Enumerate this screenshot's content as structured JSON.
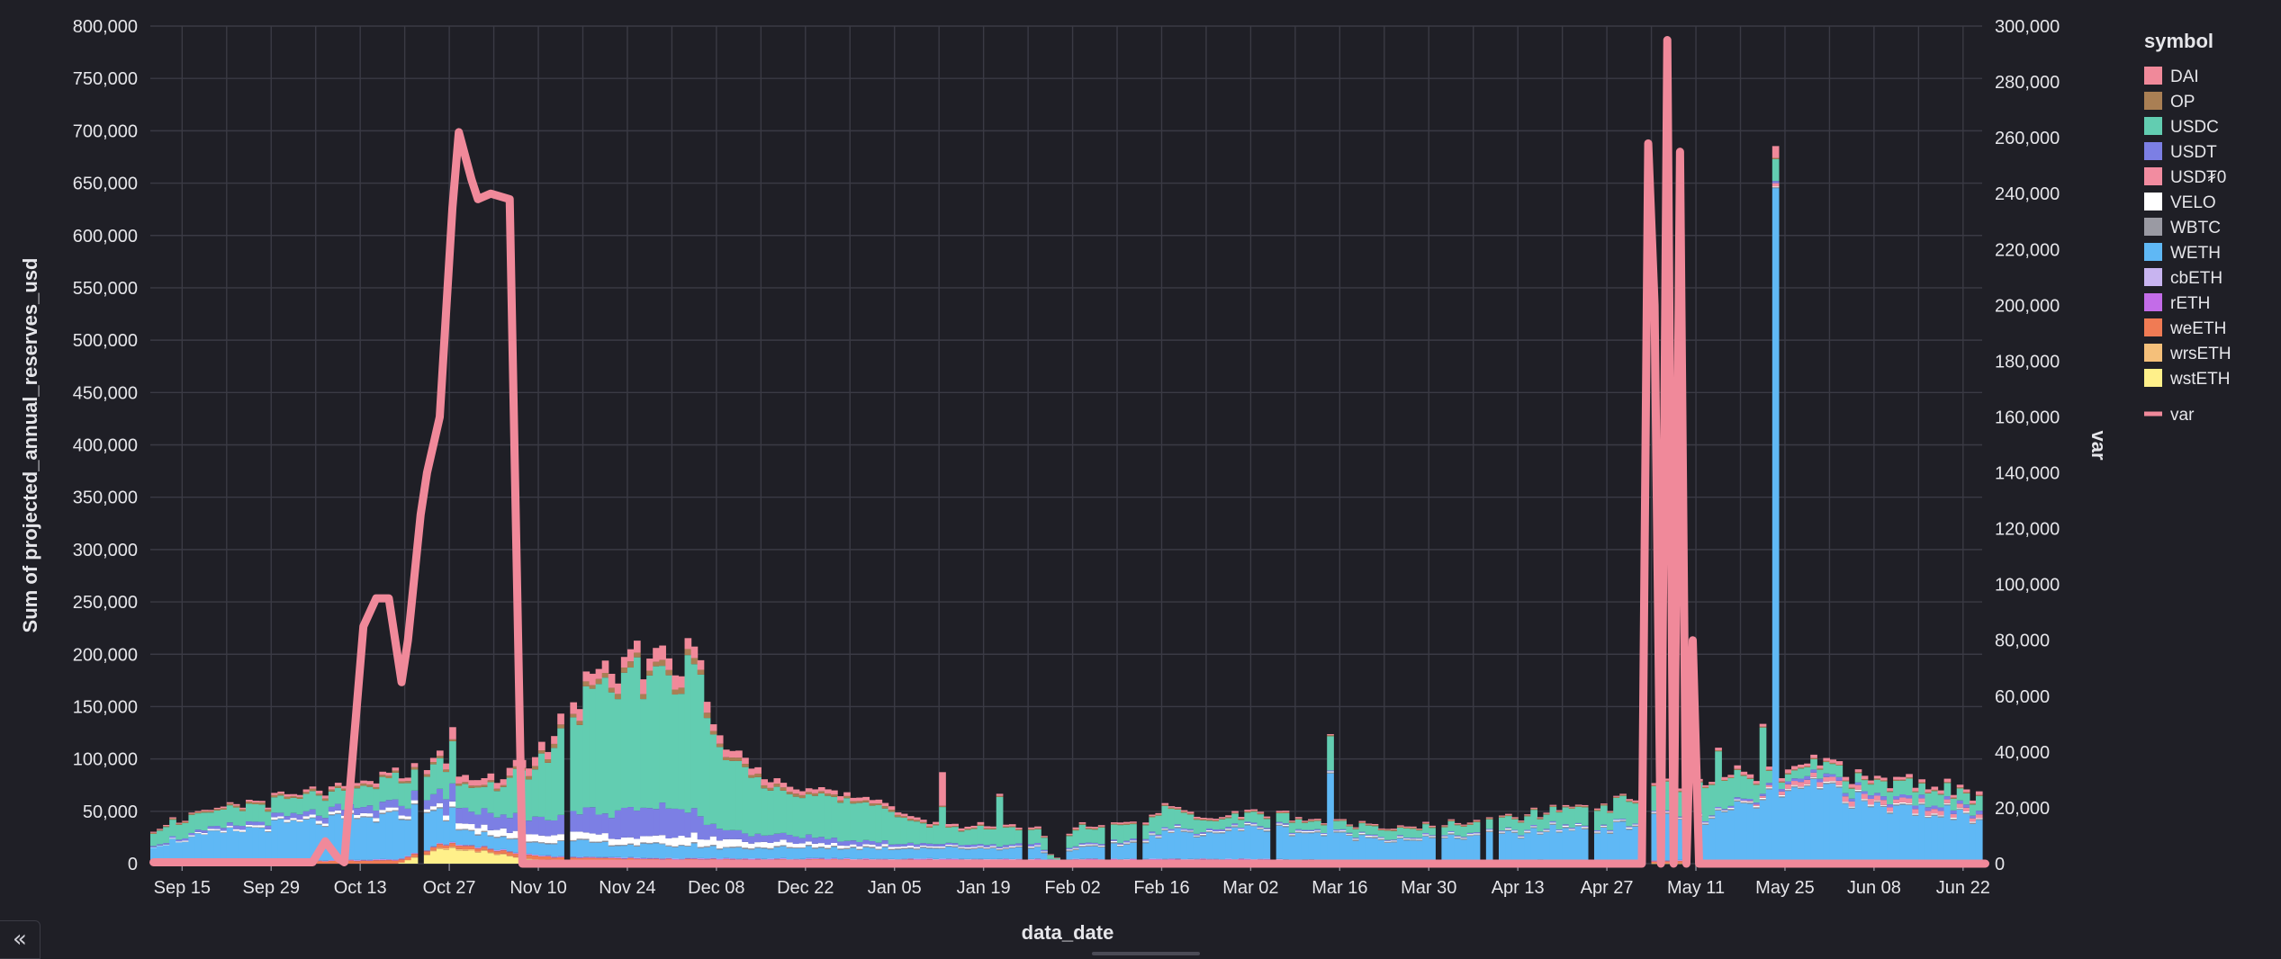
{
  "chart_data": {
    "type": "bar",
    "stacked": true,
    "xlabel": "data_date",
    "ylabel": "Sum of projected_annual_reserves_usd",
    "y2label": "var",
    "ylim": [
      0,
      800000
    ],
    "y2lim": [
      0,
      300000
    ],
    "yticks": [
      0,
      50000,
      100000,
      150000,
      200000,
      250000,
      300000,
      350000,
      400000,
      450000,
      500000,
      550000,
      600000,
      650000,
      700000,
      750000,
      800000
    ],
    "ytick_labels": [
      "0",
      "50,000",
      "100,000",
      "150,000",
      "200,000",
      "250,000",
      "300,000",
      "350,000",
      "400,000",
      "450,000",
      "500,000",
      "550,000",
      "600,000",
      "650,000",
      "700,000",
      "750,000",
      "800,000"
    ],
    "y2ticks": [
      0,
      20000,
      40000,
      60000,
      80000,
      100000,
      120000,
      140000,
      160000,
      180000,
      200000,
      220000,
      240000,
      260000,
      280000,
      300000
    ],
    "y2tick_labels": [
      "0",
      "20,000",
      "40,000",
      "60,000",
      "80,000",
      "100,000",
      "120,000",
      "140,000",
      "160,000",
      "180,000",
      "200,000",
      "220,000",
      "240,000",
      "260,000",
      "280,000",
      "300,000"
    ],
    "x_start": "Sep 10",
    "x_end": "Jun 25",
    "xtick_labels": [
      "Sep 15",
      "Sep 29",
      "Oct 13",
      "Oct 27",
      "Nov 10",
      "Nov 24",
      "Dec 08",
      "Dec 22",
      "Jan 05",
      "Jan 19",
      "Feb 02",
      "Feb 16",
      "Mar 02",
      "Mar 16",
      "Mar 30",
      "Apr 13",
      "Apr 27",
      "May 11",
      "May 25",
      "Jun 08",
      "Jun 22"
    ],
    "grid": true,
    "legend_title": "symbol",
    "legend_position": "right",
    "series_names": [
      "DAI",
      "OP",
      "USDC",
      "USDT",
      "USD₮0",
      "VELO",
      "WBTC",
      "WETH",
      "cbETH",
      "rETH",
      "weETH",
      "wrsETH",
      "wstETH"
    ],
    "series_colors": [
      "#f0899a",
      "#a97f54",
      "#62cdb1",
      "#7c7fe4",
      "#f28ca0",
      "#ffffff",
      "#9a9aa3",
      "#5fb8f5",
      "#c8b4f0",
      "#c36ce8",
      "#f07b54",
      "#f5c07a",
      "#fff08a"
    ],
    "stack_order_bottom_to_top": [
      "wstETH",
      "wrsETH",
      "weETH",
      "rETH",
      "cbETH",
      "WETH",
      "WBTC",
      "VELO",
      "USD₮0",
      "USDT",
      "USDC",
      "OP",
      "DAI"
    ],
    "anchor_days": [
      0,
      5,
      20,
      33,
      39,
      44,
      47,
      50,
      55,
      62,
      68,
      74,
      80,
      86,
      88,
      92,
      98,
      106,
      115,
      125,
      133,
      140,
      142,
      145,
      148,
      155,
      160,
      167,
      175,
      185,
      195,
      203,
      206,
      210,
      216,
      222,
      230,
      238,
      246,
      250,
      256,
      260,
      265,
      270,
      275,
      280,
      288
    ],
    "stacks": {
      "wstETH": [
        0,
        0,
        0,
        0,
        0,
        10000,
        15000,
        14000,
        8000,
        3000,
        2000,
        1500,
        1000,
        800,
        700,
        600,
        500,
        500,
        400,
        400,
        400,
        300,
        0,
        300,
        300,
        300,
        300,
        300,
        200,
        200,
        200,
        200,
        200,
        200,
        200,
        200,
        200,
        200,
        0,
        0,
        0,
        0,
        0,
        0,
        0,
        0,
        0
      ],
      "wrsETH": [
        0,
        0,
        0,
        0,
        0,
        1000,
        1500,
        1200,
        800,
        600,
        500,
        400,
        300,
        300,
        300,
        300,
        300,
        300,
        300,
        300,
        300,
        300,
        0,
        300,
        300,
        300,
        300,
        300,
        200,
        200,
        200,
        200,
        200,
        200,
        200,
        200,
        200,
        200,
        0,
        0,
        0,
        0,
        0,
        0,
        0,
        0,
        0
      ],
      "weETH": [
        0,
        1000,
        2000,
        3000,
        3000,
        3000,
        3000,
        3000,
        3000,
        3000,
        3000,
        3000,
        3000,
        3000,
        3000,
        3000,
        3000,
        3000,
        3000,
        3000,
        3000,
        3000,
        0,
        3000,
        3000,
        3000,
        3000,
        3000,
        3000,
        2000,
        2000,
        2000,
        2000,
        2000,
        2000,
        2000,
        2000,
        2000,
        2000,
        2000,
        2000,
        2000,
        2000,
        2000,
        2000,
        2000,
        2000
      ],
      "rETH": [
        0,
        0,
        0,
        500,
        500,
        500,
        500,
        500,
        500,
        500,
        500,
        500,
        500,
        500,
        500,
        500,
        500,
        500,
        500,
        500,
        500,
        500,
        0,
        500,
        500,
        500,
        500,
        500,
        500,
        500,
        500,
        500,
        500,
        500,
        500,
        500,
        500,
        500,
        500,
        500,
        500,
        500,
        500,
        500,
        500,
        500,
        500
      ],
      "cbETH": [
        0,
        0,
        0,
        500,
        500,
        500,
        500,
        500,
        500,
        500,
        500,
        500,
        500,
        500,
        500,
        500,
        500,
        500,
        500,
        500,
        500,
        500,
        0,
        500,
        500,
        500,
        500,
        500,
        500,
        500,
        500,
        500,
        500,
        500,
        500,
        500,
        500,
        500,
        500,
        500,
        500,
        500,
        500,
        500,
        500,
        500,
        500
      ],
      "WETH": [
        18000,
        22000,
        35000,
        38000,
        40000,
        42000,
        16000,
        12000,
        12000,
        13000,
        14000,
        12000,
        12000,
        12000,
        10000,
        10000,
        10000,
        10000,
        10000,
        10000,
        10000,
        10000,
        0,
        10000,
        10000,
        15000,
        25000,
        25000,
        30000,
        24000,
        20000,
        20000,
        22000,
        23000,
        25000,
        30000,
        30000,
        40000,
        40000,
        50000,
        60000,
        65000,
        70000,
        50000,
        50000,
        48000,
        40000
      ],
      "WBTC": [
        0,
        0,
        500,
        1000,
        1000,
        1000,
        1000,
        1000,
        1000,
        1000,
        1000,
        1000,
        1000,
        1000,
        1000,
        1000,
        1000,
        1000,
        1000,
        1000,
        1000,
        1000,
        0,
        1000,
        1000,
        1000,
        1000,
        1000,
        1000,
        1000,
        1000,
        1000,
        1000,
        1000,
        1000,
        1000,
        1000,
        1000,
        1000,
        1000,
        1000,
        1000,
        1000,
        1000,
        1000,
        1000,
        1000
      ],
      "VELO": [
        0,
        1000,
        2000,
        3000,
        3000,
        3000,
        6000,
        5000,
        6000,
        7000,
        7000,
        6000,
        8000,
        8000,
        7000,
        6000,
        5000,
        3000,
        2000,
        1000,
        1000,
        1000,
        0,
        1000,
        1000,
        1000,
        1000,
        1000,
        1000,
        1000,
        1000,
        1000,
        1000,
        1000,
        1000,
        1000,
        1000,
        1000,
        1000,
        1000,
        1000,
        1000,
        1000,
        1000,
        1000,
        1000,
        1000
      ],
      "USD₮0": [
        0,
        0,
        0,
        0,
        0,
        0,
        0,
        0,
        0,
        0,
        0,
        0,
        0,
        0,
        0,
        0,
        0,
        0,
        0,
        0,
        0,
        0,
        0,
        0,
        0,
        0,
        0,
        0,
        0,
        0,
        0,
        0,
        0,
        0,
        0,
        0,
        0,
        0,
        0,
        0,
        3000,
        5000,
        5000,
        5000,
        4000,
        4000,
        3000
      ],
      "USDT": [
        1000,
        2000,
        4000,
        6000,
        8000,
        9000,
        15000,
        14000,
        14000,
        16000,
        20000,
        25000,
        30000,
        22000,
        12000,
        8000,
        7000,
        5000,
        3000,
        2000,
        2000,
        2000,
        0,
        1500,
        1500,
        1500,
        1500,
        1500,
        1500,
        1000,
        1000,
        1000,
        1000,
        1000,
        1000,
        1000,
        1000,
        1000,
        1000,
        2000,
        2000,
        3000,
        3000,
        3000,
        3000,
        3000,
        3000
      ],
      "USDC": [
        10000,
        16000,
        15000,
        18000,
        22000,
        25000,
        25000,
        20000,
        28000,
        55000,
        100000,
        120000,
        130000,
        130000,
        90000,
        60000,
        50000,
        40000,
        30000,
        15000,
        15000,
        15000,
        0,
        15000,
        15000,
        15000,
        18000,
        8000,
        10000,
        7000,
        8000,
        8000,
        9000,
        10000,
        12000,
        15000,
        20000,
        25000,
        28000,
        25000,
        5000,
        10000,
        10000,
        10000,
        15000,
        12000,
        12000
      ],
      "OP": [
        1000,
        1000,
        2000,
        2000,
        2000,
        2000,
        2000,
        2000,
        2000,
        3000,
        4000,
        5000,
        5000,
        5000,
        4000,
        3000,
        3000,
        2000,
        2000,
        1000,
        1000,
        1000,
        0,
        1000,
        1000,
        1000,
        1000,
        1000,
        1000,
        1000,
        1000,
        1000,
        1000,
        1000,
        1000,
        1000,
        1000,
        1000,
        1000,
        1000,
        1000,
        1000,
        1000,
        1000,
        1000,
        1000,
        1000
      ],
      "DAI": [
        1000,
        1000,
        2000,
        3000,
        3000,
        4000,
        6000,
        6000,
        6000,
        8000,
        10000,
        12000,
        12000,
        12000,
        8000,
        6000,
        5000,
        4000,
        3000,
        2000,
        2000,
        1500,
        0,
        1500,
        1500,
        1500,
        1500,
        1500,
        1500,
        1000,
        1000,
        1000,
        1000,
        1000,
        1000,
        1000,
        1000,
        2000,
        2000,
        3000,
        3000,
        3000,
        3000,
        3000,
        3000,
        3000,
        3000
      ]
    },
    "spikes": [
      {
        "day": 47,
        "extra": {
          "WETH": 20000,
          "USDC": 20000,
          "DAI": 5000
        }
      },
      {
        "day": 133,
        "extra": {
          "USDC": 30000
        }
      },
      {
        "day": 185,
        "extra": {
          "WETH": 60000,
          "USDC": 25000
        }
      },
      {
        "day": 124,
        "extra": {
          "USDC": 20000,
          "DAI": 30000
        }
      },
      {
        "day": 255,
        "extra": {
          "WETH": 590000,
          "USDC": 15000,
          "DAI": 8000
        }
      },
      {
        "day": 253,
        "extra": {
          "USDC": 50000
        }
      },
      {
        "day": 246,
        "extra": {
          "USDC": 25000
        }
      }
    ],
    "gaps": [
      42,
      143,
      150,
      65,
      150,
      155,
      137,
      176,
      202,
      209,
      211,
      226,
      235,
      242
    ],
    "line": {
      "name": "var",
      "axis": "y2",
      "color": "#f0899a",
      "days": [
        0,
        25,
        27,
        29,
        30,
        31,
        33,
        35,
        37,
        39,
        40,
        42,
        43,
        45,
        47,
        48,
        50,
        51,
        53,
        56,
        58,
        60,
        61,
        63,
        65,
        66,
        234,
        235,
        236,
        237,
        238,
        239,
        240,
        241,
        242,
        243,
        244,
        288
      ],
      "values": [
        500,
        500,
        8000,
        2000,
        500,
        30000,
        85000,
        95000,
        95000,
        65000,
        80000,
        125000,
        140000,
        160000,
        235000,
        262000,
        245000,
        238000,
        240000,
        238000,
        0,
        0,
        0,
        0,
        0,
        0,
        0,
        258000,
        200000,
        0,
        295000,
        0,
        255000,
        0,
        80000,
        0,
        0,
        0
      ]
    }
  },
  "ui": {
    "collapse_label": "«"
  }
}
